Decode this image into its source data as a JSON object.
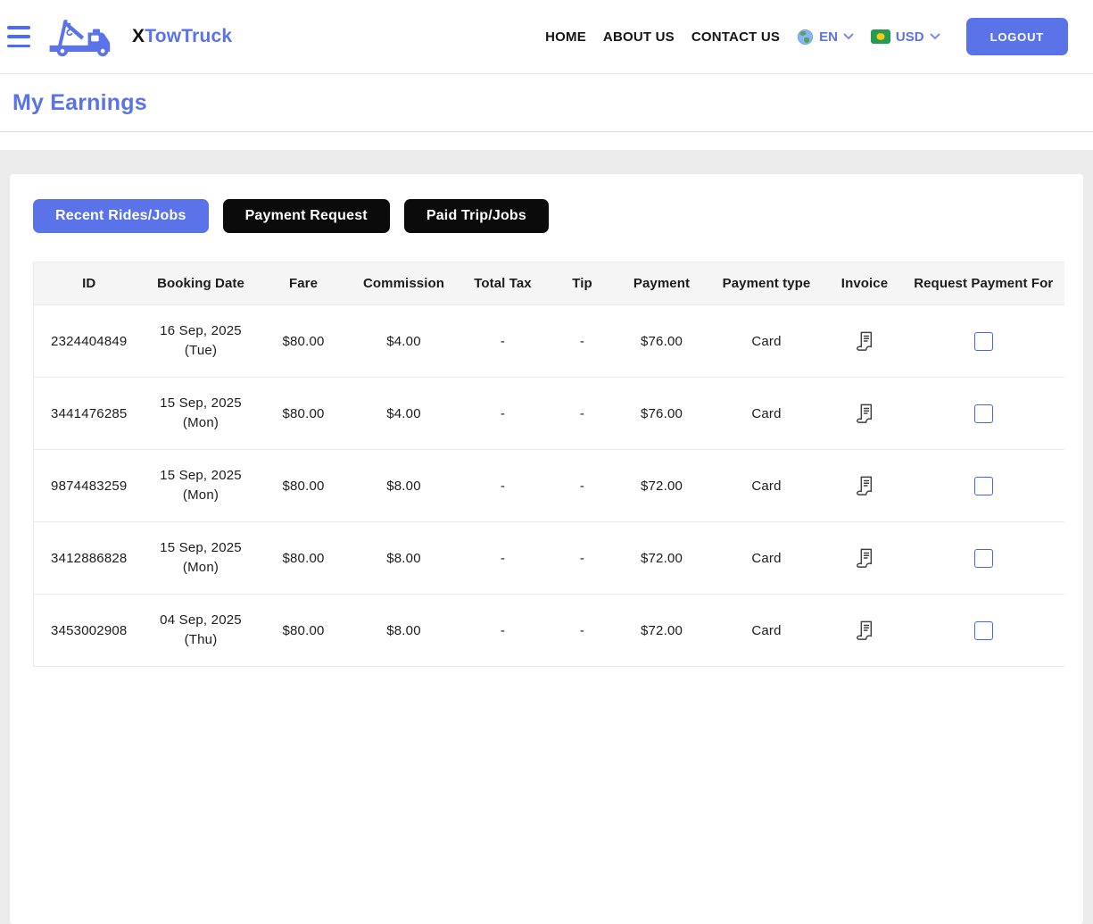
{
  "header": {
    "brand": {
      "prefix": "X",
      "rest": "TowTruck"
    },
    "nav": [
      {
        "label": "HOME"
      },
      {
        "label": "ABOUT US"
      },
      {
        "label": "CONTACT US"
      }
    ],
    "language": {
      "code": "EN"
    },
    "currency": {
      "code": "USD"
    },
    "logout_label": "LOGOUT"
  },
  "page": {
    "title": "My Earnings"
  },
  "tabs": [
    {
      "label": "Recent Rides/Jobs",
      "active": true
    },
    {
      "label": "Payment Request",
      "active": false
    },
    {
      "label": "Paid Trip/Jobs",
      "active": false
    }
  ],
  "icons": {
    "menu": "hamburger-icon",
    "logo": "tow-truck-logo-icon",
    "language": "globe-icon",
    "currency": "currency-flag-icon",
    "dropdown": "chevron-down-icon",
    "invoice": "receipt-icon"
  },
  "table": {
    "columns": [
      "ID",
      "Booking Date",
      "Fare",
      "Commission",
      "Total Tax",
      "Tip",
      "Payment",
      "Payment type",
      "Invoice",
      "Request Payment For"
    ],
    "rows": [
      {
        "id": "2324404849",
        "booking_date": "16 Sep, 2025",
        "booking_day": "(Tue)",
        "fare": "$80.00",
        "commission": "$4.00",
        "total_tax": "-",
        "tip": "-",
        "payment": "$76.00",
        "payment_type": "Card",
        "request_checked": false
      },
      {
        "id": "3441476285",
        "booking_date": "15 Sep, 2025",
        "booking_day": "(Mon)",
        "fare": "$80.00",
        "commission": "$4.00",
        "total_tax": "-",
        "tip": "-",
        "payment": "$76.00",
        "payment_type": "Card",
        "request_checked": false
      },
      {
        "id": "9874483259",
        "booking_date": "15 Sep, 2025",
        "booking_day": "(Mon)",
        "fare": "$80.00",
        "commission": "$8.00",
        "total_tax": "-",
        "tip": "-",
        "payment": "$72.00",
        "payment_type": "Card",
        "request_checked": false
      },
      {
        "id": "3412886828",
        "booking_date": "15 Sep, 2025",
        "booking_day": "(Mon)",
        "fare": "$80.00",
        "commission": "$8.00",
        "total_tax": "-",
        "tip": "-",
        "payment": "$72.00",
        "payment_type": "Card",
        "request_checked": false
      },
      {
        "id": "3453002908",
        "booking_date": "04 Sep, 2025",
        "booking_day": "(Thu)",
        "fare": "$80.00",
        "commission": "$8.00",
        "total_tax": "-",
        "tip": "-",
        "payment": "$72.00",
        "payment_type": "Card",
        "request_checked": false
      }
    ]
  },
  "colors": {
    "accent": "#5b73e8",
    "tab_inactive": "#0b0b0b",
    "page_background": "#ececec",
    "checkbox_border": "#4169e1",
    "table_header_background": "#f5f5f6"
  }
}
